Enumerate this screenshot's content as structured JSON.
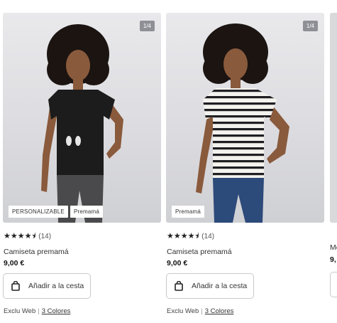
{
  "products": [
    {
      "image_counter": "1/4",
      "tags": [
        "PERSONALIZABLE",
        "Premamá"
      ],
      "stars": "★★★★⯨",
      "rating_count": "(14)",
      "title": "Camiseta premamá",
      "price": "9,00 €",
      "add_label": "Añadir a la cesta",
      "exclusive": "Exclu Web",
      "colors_link": "3 Colores",
      "shirt": "black"
    },
    {
      "image_counter": "1/4",
      "tags": [
        "Premamá"
      ],
      "stars": "★★★★⯨",
      "rating_count": "(14)",
      "title": "Camiseta premamá",
      "price": "9,00 €",
      "add_label": "Añadir a la cesta",
      "exclusive": "Exclu Web",
      "colors_link": "3 Colores",
      "shirt": "striped"
    }
  ],
  "peek": {
    "title": "Me",
    "price": "9,"
  },
  "colors": {
    "shirt_black": "#1c1c1c",
    "pants_grey": "#4a4a4c",
    "jeans_blue": "#2c4a7a",
    "skin": "#8a5a3c",
    "hair": "#1b1411"
  }
}
